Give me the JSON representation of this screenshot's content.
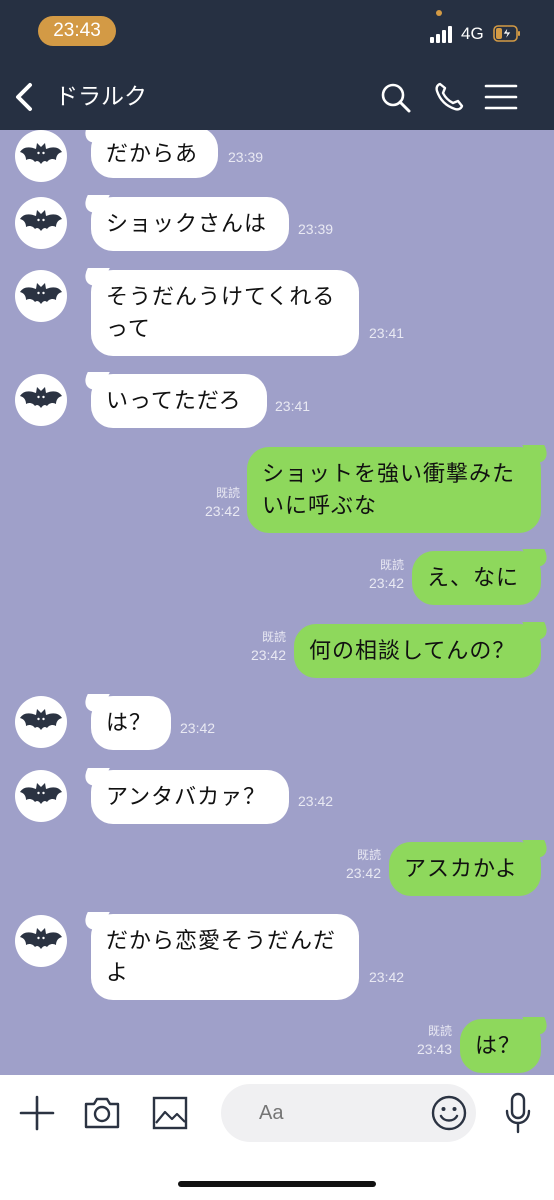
{
  "status_bar": {
    "time": "23:43",
    "network": "4G"
  },
  "header": {
    "title": "ドラルク"
  },
  "messages": [
    {
      "side": "in",
      "lines": [
        "だからあ"
      ],
      "time": "23:39"
    },
    {
      "side": "in",
      "lines": [
        "ショックさんは"
      ],
      "time": "23:39"
    },
    {
      "side": "in",
      "lines": [
        "そうだんうけてくれる",
        "って"
      ],
      "time": "23:41"
    },
    {
      "side": "in",
      "lines": [
        "いってただろ"
      ],
      "time": "23:41"
    },
    {
      "side": "out",
      "lines": [
        "ショットを強い衝撃みた",
        "いに呼ぶな"
      ],
      "time": "23:42",
      "read": "既読"
    },
    {
      "side": "out",
      "lines": [
        "え、なに"
      ],
      "time": "23:42",
      "read": "既読"
    },
    {
      "side": "out",
      "lines": [
        "何の相談してんの？"
      ],
      "time": "23:42",
      "read": "既読"
    },
    {
      "side": "in",
      "lines": [
        "は？"
      ],
      "time": "23:42"
    },
    {
      "side": "in",
      "lines": [
        "アンタバカァ？"
      ],
      "time": "23:42"
    },
    {
      "side": "out",
      "lines": [
        "アスカかよ"
      ],
      "time": "23:42",
      "read": "既読"
    },
    {
      "side": "in",
      "lines": [
        "だから恋愛そうだんだ",
        "よ"
      ],
      "time": "23:42"
    },
    {
      "side": "out",
      "lines": [
        "は？"
      ],
      "time": "23:43",
      "read": "既読"
    }
  ],
  "input": {
    "placeholder": "Aa"
  },
  "icons": {
    "back": "chevron-left-icon",
    "search": "search-icon",
    "call": "phone-icon",
    "menu": "menu-icon",
    "add": "plus-icon",
    "camera": "camera-icon",
    "image": "image-icon",
    "emoji": "emoji-icon",
    "mic": "microphone-icon"
  },
  "colors": {
    "header_bg": "#263042",
    "chat_bg": "#9fa0c9",
    "outgoing_bubble": "#8ed85c",
    "incoming_bubble": "#ffffff",
    "time_pill": "#d39a45"
  }
}
